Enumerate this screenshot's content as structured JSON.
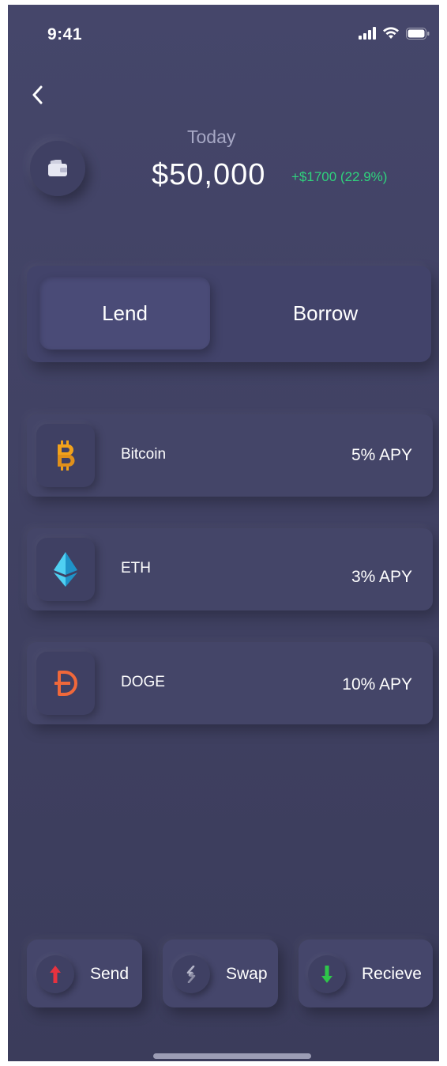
{
  "status_bar": {
    "time": "9:41"
  },
  "header": {
    "today_label": "Today",
    "balance": "$50,000",
    "change": "+$1700 (22.9%)"
  },
  "toggle": {
    "lend_label": "Lend",
    "borrow_label": "Borrow",
    "active": "Lend"
  },
  "assets": [
    {
      "name": "Bitcoin",
      "apy": "5% APY",
      "icon": "bitcoin-icon",
      "color": "#f2a21b"
    },
    {
      "name": "ETH",
      "apy": "3% APY",
      "icon": "ethereum-icon",
      "color": "#2fb6e6"
    },
    {
      "name": "DOGE",
      "apy": "10% APY",
      "icon": "dogecoin-icon",
      "color": "#f0683a"
    }
  ],
  "actions": [
    {
      "label": "Send",
      "icon": "arrow-up-icon",
      "color": "#e7323f"
    },
    {
      "label": "Swap",
      "icon": "swap-icon",
      "color": "#b4b5c8"
    },
    {
      "label": "Recieve",
      "icon": "arrow-down-icon",
      "color": "#2ec74a"
    }
  ],
  "colors": {
    "background": "#414264",
    "positive": "#2fd37d"
  }
}
